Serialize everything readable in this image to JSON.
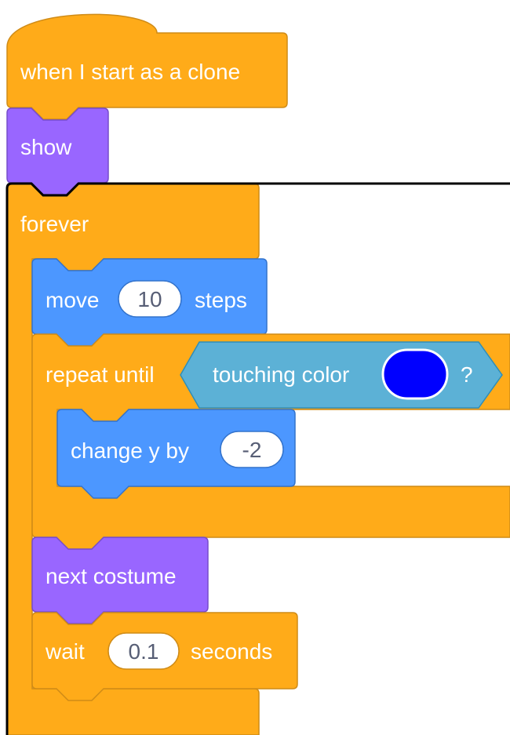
{
  "colors": {
    "control": "#ffab19",
    "control_stroke": "#cf8b17",
    "looks": "#9966ff",
    "looks_stroke": "#774dcb",
    "motion": "#4c97ff",
    "motion_stroke": "#3373cc",
    "sensing": "#5cb1d6",
    "sensing_stroke": "#2e8eb8",
    "selected_outline": "#000000",
    "touch_color_swatch": "#0000ff"
  },
  "blocks": {
    "hat": {
      "label": "when I start as a clone"
    },
    "show": {
      "label": "show"
    },
    "forever": {
      "label": "forever"
    },
    "move": {
      "label_before": "move",
      "value": "10",
      "label_after": "steps"
    },
    "repeat_until": {
      "label": "repeat until",
      "condition": {
        "label": "touching color",
        "suffix": "?",
        "swatch_icon": "color-swatch"
      }
    },
    "change_y": {
      "label": "change y by",
      "value": "-2"
    },
    "next_costume": {
      "label": "next costume"
    },
    "wait": {
      "label_before": "wait",
      "value": "0.1",
      "label_after": "seconds"
    }
  }
}
